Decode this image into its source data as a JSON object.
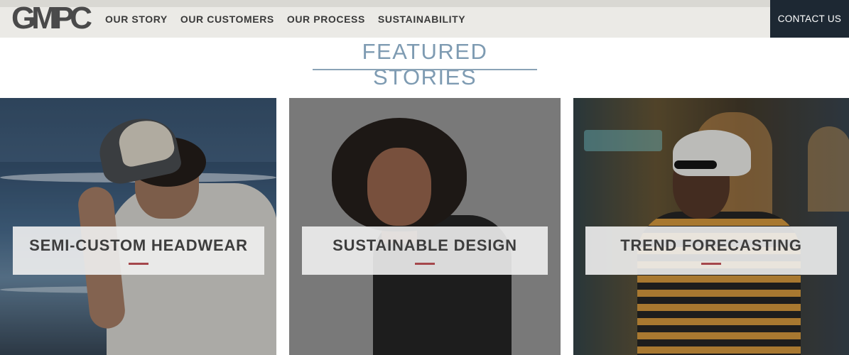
{
  "header": {
    "logo_text": "GMPC",
    "nav": [
      {
        "label": "OUR STORY"
      },
      {
        "label": "OUR CUSTOMERS"
      },
      {
        "label": "OUR PROCESS"
      },
      {
        "label": "SUSTAINABILITY"
      }
    ],
    "contact_label": "CONTACT US"
  },
  "featured": {
    "title": "FEATURED STORIES",
    "cards": [
      {
        "label": "SEMI-CUSTOM HEADWEAR",
        "image": "man-in-trucker-cap-beach-photo"
      },
      {
        "label": "SUSTAINABLE DESIGN",
        "image": "smiling-woman-black-tee-photo"
      },
      {
        "label": "TREND FORECASTING",
        "image": "man-in-bucket-hat-night-street-photo"
      }
    ]
  },
  "colors": {
    "header_bg": "#ebeae6",
    "contact_bg": "#1d2833",
    "title_color": "#7e9bb2",
    "accent_rule": "#a5474c"
  }
}
